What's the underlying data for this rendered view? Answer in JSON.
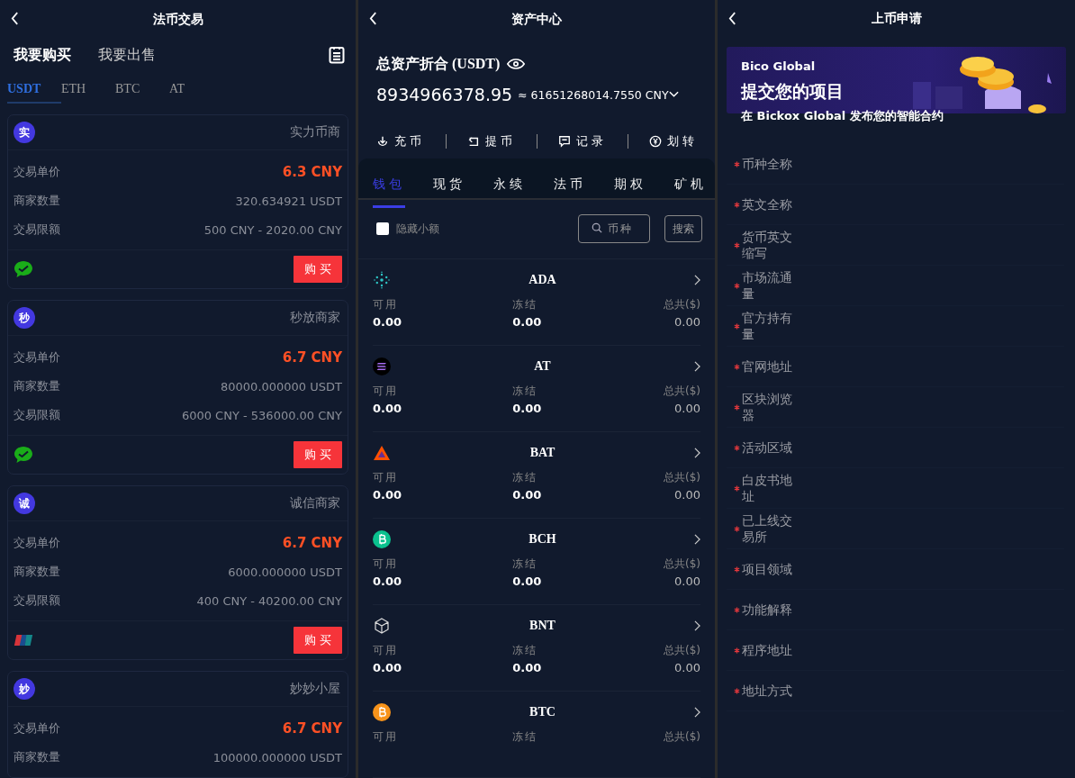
{
  "fiat_trade": {
    "title": "法币交易",
    "trade_tabs": [
      {
        "label": "我要购买",
        "selected": true
      },
      {
        "label": "我要出售",
        "selected": false
      }
    ],
    "coin_tabs": [
      {
        "label": "USDT",
        "selected": true
      },
      {
        "label": "ETH",
        "selected": false
      },
      {
        "label": "BTC",
        "selected": false
      },
      {
        "label": "AT",
        "selected": false
      }
    ],
    "merchants": [
      {
        "avatar": "实",
        "name": "实力币商",
        "rows": [
          {
            "label": "交易单价",
            "value": "6.3 CNY",
            "kind": "price"
          },
          {
            "label": "商家数量",
            "value": "320.634921 USDT",
            "kind": "plain"
          },
          {
            "label": "交易限额",
            "value": "500 CNY - 2020.00 CNY",
            "kind": "plain"
          }
        ],
        "payment": {
          "kind": "wechat"
        },
        "button": "购买"
      },
      {
        "avatar": "秒",
        "name": "秒放商家",
        "rows": [
          {
            "label": "交易单价",
            "value": "6.7 CNY",
            "kind": "price"
          },
          {
            "label": "商家数量",
            "value": "80000.000000 USDT",
            "kind": "plain"
          },
          {
            "label": "交易限额",
            "value": "6000 CNY - 536000.00 CNY",
            "kind": "plain"
          }
        ],
        "payment": {
          "kind": "wechat"
        },
        "button": "购买"
      },
      {
        "avatar": "诚",
        "name": "诚信商家",
        "rows": [
          {
            "label": "交易单价",
            "value": "6.7 CNY",
            "kind": "price"
          },
          {
            "label": "商家数量",
            "value": "6000.000000 USDT",
            "kind": "plain"
          },
          {
            "label": "交易限额",
            "value": "400 CNY - 40200.00 CNY",
            "kind": "plain"
          }
        ],
        "payment": {
          "kind": "unionpay"
        },
        "button": "购买"
      },
      {
        "avatar": "妙",
        "name": "妙妙小屋",
        "rows": [
          {
            "label": "交易单价",
            "value": "6.7 CNY",
            "kind": "price"
          },
          {
            "label": "商家数量",
            "value": "100000.000000 USDT",
            "kind": "plain"
          }
        ]
      }
    ]
  },
  "asset_center": {
    "title": "资产中心",
    "total_label": "总资产折合 (USDT)",
    "total": "8934966378.95",
    "cny": "≈ 61651268014.7550 CNY",
    "actions": [
      {
        "label": "充币",
        "kind": "deposit"
      },
      {
        "label": "提币",
        "kind": "withdraw"
      },
      {
        "label": "记录",
        "kind": "record"
      },
      {
        "label": "划转",
        "kind": "transfer"
      }
    ],
    "tabs": [
      {
        "label": "钱包",
        "selected": true
      },
      {
        "label": "现货",
        "selected": false
      },
      {
        "label": "永续",
        "selected": false
      },
      {
        "label": "法币",
        "selected": false
      },
      {
        "label": "期权",
        "selected": false
      },
      {
        "label": "矿机",
        "selected": false
      }
    ],
    "hide_small": {
      "label": "隐藏小额",
      "checked": false
    },
    "coin_search": {
      "placeholder": "币种"
    },
    "search_button": "搜索",
    "assets": [
      {
        "symbol": "ADA",
        "kind": "ada",
        "columns": [
          {
            "label": "可用",
            "value": "0.00"
          },
          {
            "label": "冻结",
            "value": "0.00"
          },
          {
            "label": "总共($)",
            "value": "0.00"
          }
        ]
      },
      {
        "symbol": "AT",
        "kind": "sol",
        "columns": [
          {
            "label": "可用",
            "value": "0.00"
          },
          {
            "label": "冻结",
            "value": "0.00"
          },
          {
            "label": "总共($)",
            "value": "0.00"
          }
        ]
      },
      {
        "symbol": "BAT",
        "kind": "bat",
        "columns": [
          {
            "label": "可用",
            "value": "0.00"
          },
          {
            "label": "冻结",
            "value": "0.00"
          },
          {
            "label": "总共($)",
            "value": "0.00"
          }
        ]
      },
      {
        "symbol": "BCH",
        "kind": "bch",
        "columns": [
          {
            "label": "可用",
            "value": "0.00"
          },
          {
            "label": "冻结",
            "value": "0.00"
          },
          {
            "label": "总共($)",
            "value": "0.00"
          }
        ]
      },
      {
        "symbol": "BNT",
        "kind": "bnt",
        "columns": [
          {
            "label": "可用",
            "value": "0.00"
          },
          {
            "label": "冻结",
            "value": "0.00"
          },
          {
            "label": "总共($)",
            "value": "0.00"
          }
        ]
      },
      {
        "symbol": "BTC",
        "kind": "btc",
        "columns": [
          {
            "label": "可用"
          },
          {
            "label": "冻结"
          },
          {
            "label": "总共($)"
          }
        ]
      }
    ]
  },
  "listing_application": {
    "title": "上币申请",
    "banner": {
      "brand": "Bico Global",
      "headline": "提交您的项目",
      "subtitle": "在 Bickox Global 发布您的智能合约"
    },
    "fields": [
      {
        "label": "币种全称",
        "required": true
      },
      {
        "label": "英文全称",
        "required": true
      },
      {
        "label": "货币英文缩写",
        "required": true
      },
      {
        "label": "市场流通量",
        "required": true
      },
      {
        "label": "官方持有量",
        "required": true
      },
      {
        "label": "官网地址",
        "required": true
      },
      {
        "label": "区块浏览器",
        "required": true
      },
      {
        "label": "活动区域",
        "required": true
      },
      {
        "label": "白皮书地址",
        "required": true
      },
      {
        "label": "已上线交易所",
        "required": true
      },
      {
        "label": "项目领域",
        "required": true
      },
      {
        "label": "功能解释",
        "required": true
      },
      {
        "label": "程序地址",
        "required": true
      },
      {
        "label": "地址方式",
        "required": true
      }
    ]
  }
}
